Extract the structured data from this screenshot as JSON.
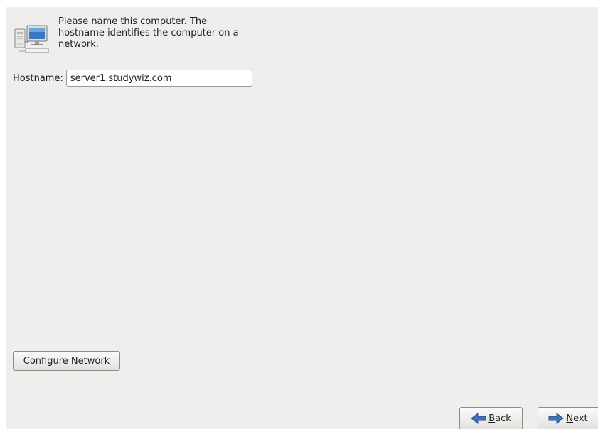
{
  "header": {
    "icon": "network-computers-icon",
    "description_lines": [
      "Please name this computer.  The",
      "hostname identifies the computer on a",
      "network."
    ]
  },
  "hostname": {
    "label": "Hostname:",
    "value": "server1.studywiz.com"
  },
  "buttons": {
    "configure_network": "Configure Network",
    "back": {
      "mnemonic": "B",
      "rest": "ack",
      "icon": "arrow-left-icon"
    },
    "next": {
      "mnemonic": "N",
      "rest": "ext",
      "icon": "arrow-right-icon"
    }
  },
  "colors": {
    "panel_background": "#efeeed",
    "arrow_blue": "#3f6fb5"
  }
}
